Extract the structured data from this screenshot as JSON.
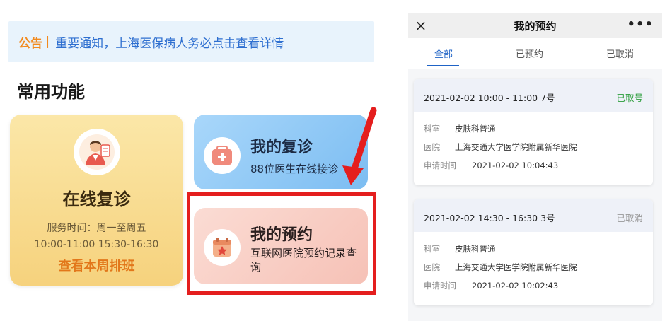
{
  "left": {
    "notice": {
      "tag": "公告",
      "separator": "|",
      "message": "重要通知，上海医保病人务必点击查看详情"
    },
    "section_title": "常用功能",
    "online": {
      "title": "在线复诊",
      "hours_line1": "服务时间：周一至周五",
      "hours_line2": "10:00-11:00 15:30-16:30",
      "link": "查看本周排班"
    },
    "follow_up": {
      "title": "我的复诊",
      "subtitle": "88位医生在线接诊"
    },
    "appointment": {
      "title": "我的预约",
      "subtitle": "互联网医院预约记录查询"
    },
    "colors": {
      "highlight": "#e41e1e",
      "notice_tag": "#f28a1e",
      "notice_text": "#2e6fd0"
    }
  },
  "right": {
    "topbar": {
      "close_icon": "×",
      "title": "我的预约",
      "more_icon": "•••"
    },
    "tabs": [
      {
        "label": "全部",
        "active": true
      },
      {
        "label": "已预约",
        "active": false
      },
      {
        "label": "已取消",
        "active": false
      }
    ],
    "appointments": [
      {
        "datetime": "2021-02-02  10:00 - 11:00  7号",
        "status": "已取号",
        "status_color": "#2a9d3a",
        "dept_label": "科室",
        "dept": "皮肤科普通",
        "hospital_label": "医院",
        "hospital": "上海交通大学医学院附属新华医院",
        "time_label": "申请时间",
        "time": "2021-02-02 10:04:43"
      },
      {
        "datetime": "2021-02-02  14:30 - 16:30  3号",
        "status": "已取消",
        "status_color": "#999999",
        "dept_label": "科室",
        "dept": "皮肤科普通",
        "hospital_label": "医院",
        "hospital": "上海交通大学医学院附属新华医院",
        "time_label": "申请时间",
        "time": "2021-02-02 10:02:43"
      }
    ]
  }
}
